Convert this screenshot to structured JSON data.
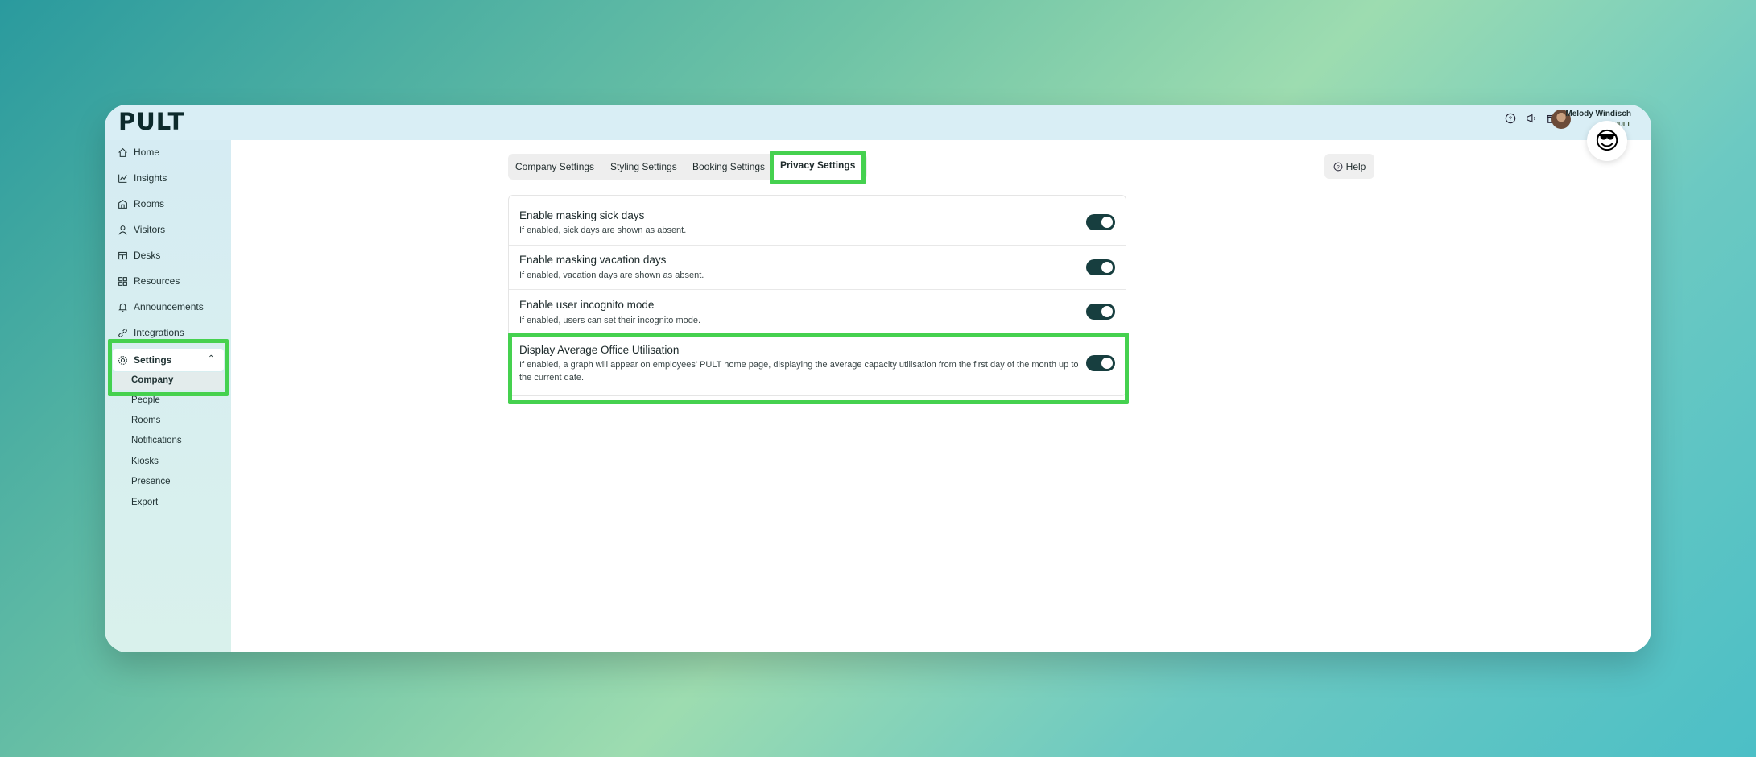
{
  "app": {
    "logo": "PULT"
  },
  "user": {
    "name": "Melody Windisch",
    "org": "PULT"
  },
  "emoji": "😎",
  "sidebar": {
    "items": [
      {
        "label": "Home",
        "icon": "home-icon"
      },
      {
        "label": "Insights",
        "icon": "chart-icon"
      },
      {
        "label": "Rooms",
        "icon": "rooms-icon"
      },
      {
        "label": "Visitors",
        "icon": "user-icon"
      },
      {
        "label": "Desks",
        "icon": "desk-icon"
      },
      {
        "label": "Resources",
        "icon": "resources-icon"
      },
      {
        "label": "Announcements",
        "icon": "bell-icon"
      },
      {
        "label": "Integrations",
        "icon": "link-icon"
      },
      {
        "label": "Settings",
        "icon": "gear-icon"
      }
    ],
    "settings_sub": [
      "Company",
      "People",
      "Rooms",
      "Notifications",
      "Kiosks",
      "Presence",
      "Export"
    ]
  },
  "tabs": [
    "Company Settings",
    "Styling Settings",
    "Booking Settings",
    "Privacy Settings"
  ],
  "active_tab": "Privacy Settings",
  "help_label": "Help",
  "settings": [
    {
      "title": "Enable masking sick days",
      "description": "If enabled, sick days are shown as absent.",
      "enabled": true
    },
    {
      "title": "Enable masking vacation days",
      "description": "If enabled, vacation days are shown as absent.",
      "enabled": true
    },
    {
      "title": "Enable user incognito mode",
      "description": "If enabled, users can set their incognito mode.",
      "enabled": true
    },
    {
      "title": "Display Average Office Utilisation",
      "description": "If enabled, a graph will appear on employees' PULT home page, displaying the average capacity utilisation from the first day of the month up to the current date.",
      "enabled": true
    }
  ],
  "colors": {
    "highlight": "#45d14f",
    "toggle_on": "#173e3f"
  }
}
